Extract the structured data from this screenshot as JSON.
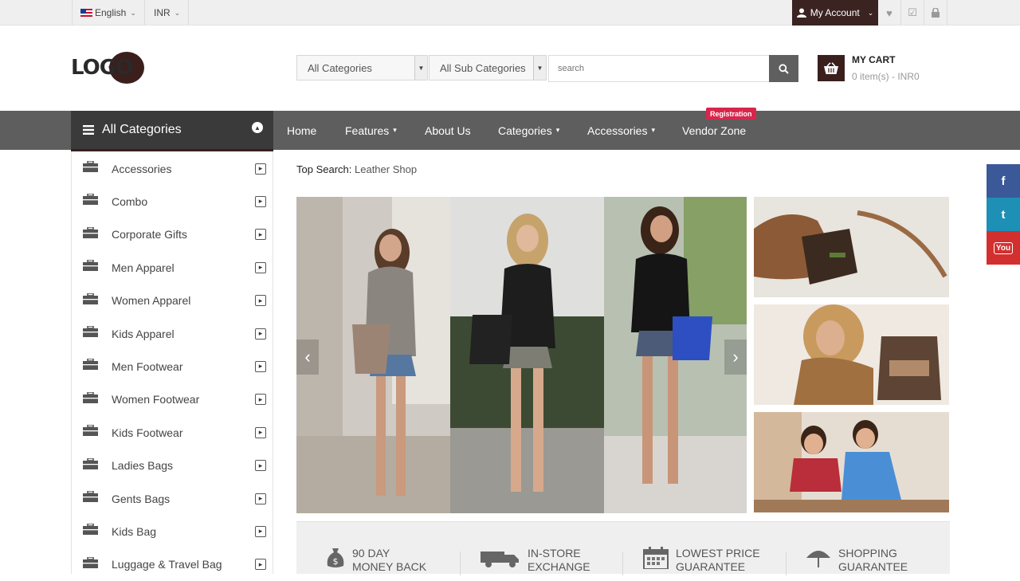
{
  "topbar": {
    "language": "English",
    "currency": "INR",
    "account_label": "My Account"
  },
  "header": {
    "logo_text": "LOGO",
    "category_select": "All Categories",
    "subcategory_select": "All Sub Categories",
    "search_placeholder": "search",
    "cart_title": "MY CART",
    "cart_summary": "0 item(s) - INR0"
  },
  "nav": {
    "all_categories": "All Categories",
    "links": [
      {
        "label": "Home",
        "dropdown": false
      },
      {
        "label": "Features",
        "dropdown": true
      },
      {
        "label": "About Us",
        "dropdown": false
      },
      {
        "label": "Categories",
        "dropdown": true
      },
      {
        "label": "Accessories",
        "dropdown": true
      },
      {
        "label": "Vendor Zone",
        "dropdown": false
      }
    ],
    "badge": "Registration"
  },
  "sidebar": {
    "items": [
      {
        "label": "Accessories"
      },
      {
        "label": "Combo"
      },
      {
        "label": "Corporate Gifts"
      },
      {
        "label": "Men Apparel"
      },
      {
        "label": "Women Apparel"
      },
      {
        "label": "Kids Apparel"
      },
      {
        "label": "Men Footwear"
      },
      {
        "label": "Women Footwear"
      },
      {
        "label": "Kids Footwear"
      },
      {
        "label": "Ladies Bags"
      },
      {
        "label": "Gents Bags"
      },
      {
        "label": "Kids Bag"
      },
      {
        "label": "Luggage & Travel Bag"
      }
    ]
  },
  "main": {
    "top_search_label": "Top Search:",
    "top_search_value": "Leather Shop"
  },
  "features": [
    {
      "line1": "90 DAY",
      "line2": "MONEY BACK",
      "icon": "money-bag-icon"
    },
    {
      "line1": "IN-STORE",
      "line2": "EXCHANGE",
      "icon": "truck-icon"
    },
    {
      "line1": "LOWEST PRICE",
      "line2": "GUARANTEE",
      "icon": "calendar-icon"
    },
    {
      "line1": "SHOPPING",
      "line2": "GUARANTEE",
      "icon": "umbrella-icon"
    }
  ],
  "social": [
    {
      "name": "facebook",
      "glyph": "f",
      "color": "#3b5998"
    },
    {
      "name": "twitter",
      "glyph": "t",
      "color": "#1e8fb5"
    },
    {
      "name": "youtube",
      "glyph": "You",
      "color": "#d32f2f"
    }
  ],
  "colors": {
    "brand": "#3a1f1d",
    "nav": "#5e5e5e",
    "badge": "#d8264b"
  }
}
